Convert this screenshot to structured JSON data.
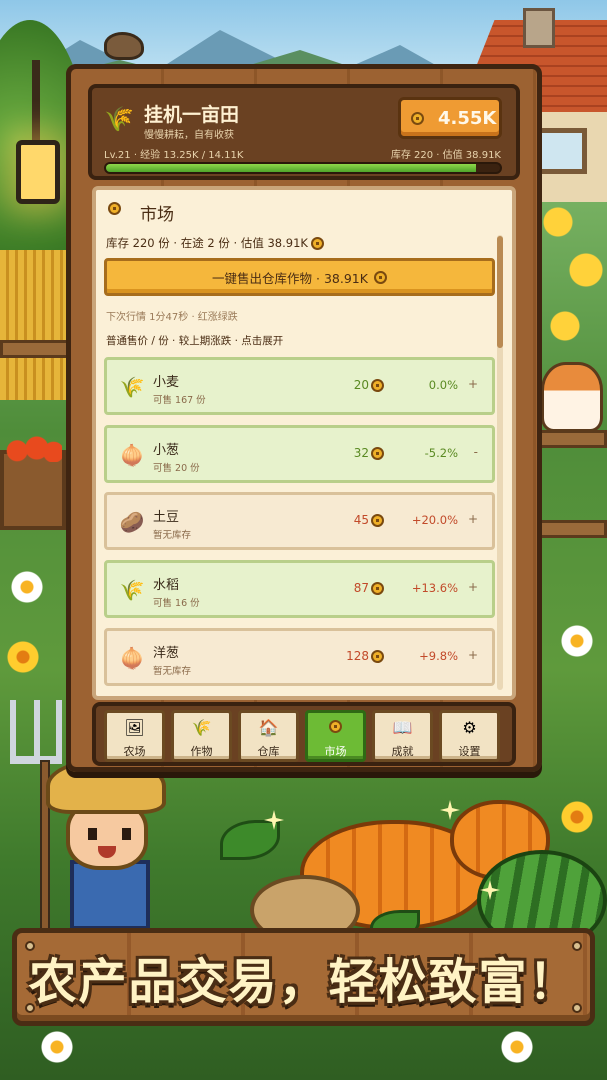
{
  "app": {
    "title": "挂机一亩田",
    "subtitle": "慢慢耕耘，自有收获",
    "coins": "4.55K",
    "level": "Lv.21",
    "xp_text": "经验 13.25K / 14.11K",
    "xp_progress": 0.939,
    "store_text": "库存 220 · 估值 38.91K"
  },
  "market": {
    "title": "市场",
    "stock_summary": "库存 220 份 · 在途 2 份 · 估值 38.91K",
    "sell_all_label": "一键售出仓库作物 · 38.91K",
    "next_quote": "下次行情 1分47秒 · 红涨绿跌",
    "price_header": "普通售价 / 份 · 较上期涨跌 · 点击展开",
    "crops": [
      {
        "name": "小麦",
        "stock": "可售 167 份",
        "price": "20",
        "change": "0.0%",
        "trend": "+",
        "icon": "wheat-icon",
        "has_stock": true,
        "direction": "flat"
      },
      {
        "name": "小葱",
        "stock": "可售 20 份",
        "price": "32",
        "change": "-5.2%",
        "trend": "-",
        "icon": "scallion-icon",
        "has_stock": true,
        "direction": "down"
      },
      {
        "name": "土豆",
        "stock": "暂无库存",
        "price": "45",
        "change": "+20.0%",
        "trend": "+",
        "icon": "potato-icon",
        "has_stock": false,
        "direction": "up"
      },
      {
        "name": "水稻",
        "stock": "可售 16 份",
        "price": "87",
        "change": "+13.6%",
        "trend": "+",
        "icon": "rice-icon",
        "has_stock": true,
        "direction": "up"
      },
      {
        "name": "洋葱",
        "stock": "暂无库存",
        "price": "128",
        "change": "+9.8%",
        "trend": "+",
        "icon": "onion-icon",
        "has_stock": false,
        "direction": "up"
      }
    ]
  },
  "nav": [
    {
      "label": "农场",
      "icon": "farm-icon",
      "active": false
    },
    {
      "label": "作物",
      "icon": "crops-icon",
      "active": false
    },
    {
      "label": "仓库",
      "icon": "warehouse-icon",
      "active": false
    },
    {
      "label": "市场",
      "icon": "market-coin-icon",
      "active": true
    },
    {
      "label": "成就",
      "icon": "book-icon",
      "active": false
    },
    {
      "label": "设置",
      "icon": "gear-icon",
      "active": false
    }
  ],
  "banner": {
    "text": "农产品交易，轻松致富！"
  },
  "colors": {
    "accent_orange": "#ef9b33",
    "active_green": "#6dbb35",
    "price_up_red": "#c24a2a",
    "price_down_green": "#5a8a22",
    "panel_bg": "#fbf0d7"
  }
}
